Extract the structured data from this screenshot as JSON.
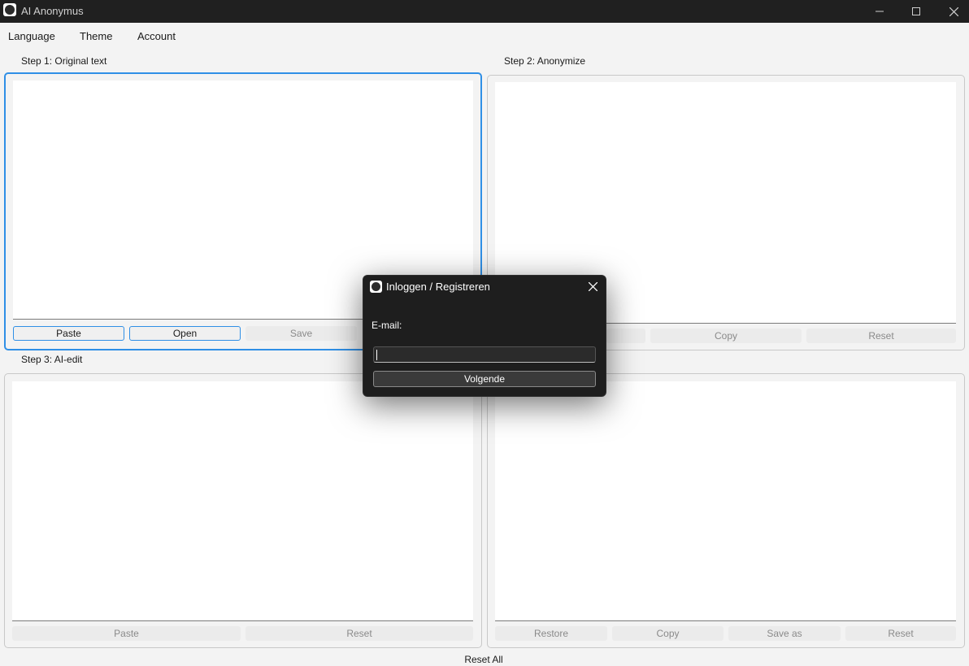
{
  "window": {
    "title": "AI Anonymus"
  },
  "menu": {
    "language": "Language",
    "theme": "Theme",
    "account": "Account"
  },
  "step1": {
    "label": "Step 1: Original text",
    "text": "",
    "paste": "Paste",
    "open": "Open",
    "save": "Save"
  },
  "step2": {
    "label": "Step 2: Anonymize",
    "text": "",
    "copy": "Copy",
    "reset": "Reset"
  },
  "step3": {
    "label": "Step 3: AI-edit",
    "text": "",
    "paste": "Paste",
    "reset": "Reset"
  },
  "step4": {
    "text": "",
    "restore": "Restore",
    "copy": "Copy",
    "save_as": "Save as",
    "reset": "Reset"
  },
  "reset_all": "Reset All",
  "dialog": {
    "title": "Inloggen / Registreren",
    "email_label": "E-mail:",
    "email_value": "",
    "next": "Volgende"
  },
  "colors": {
    "accent": "#2f8fe6",
    "titlebar": "#202020",
    "dialog_bg": "#1e1e1e"
  }
}
